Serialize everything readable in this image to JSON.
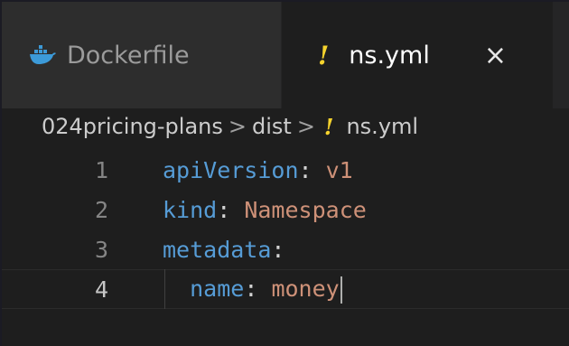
{
  "tabs": [
    {
      "label": "Dockerfile",
      "icon": "docker-whale-icon",
      "active": false
    },
    {
      "label": "ns.yml",
      "icon": "yaml-exclamation-icon",
      "active": true,
      "close": "×"
    }
  ],
  "breadcrumb": {
    "parts": [
      "024pricing-plans",
      "dist",
      "ns.yml"
    ],
    "separator": ">",
    "file_icon": "!"
  },
  "editor": {
    "lines": [
      {
        "number": "1",
        "key": "apiVersion",
        "colon": ":",
        "value": " v1"
      },
      {
        "number": "2",
        "key": "kind",
        "colon": ":",
        "value": " Namespace"
      },
      {
        "number": "3",
        "key": "metadata",
        "colon": ":",
        "value": ""
      },
      {
        "number": "4",
        "key": "name",
        "colon": ":",
        "value": " money",
        "indent": "  "
      }
    ],
    "active_line": "4"
  },
  "colors": {
    "yaml_icon": "#f6d32d",
    "docker_icon": "#3c9ad8",
    "key": "#569cd6",
    "value": "#ce9178"
  }
}
